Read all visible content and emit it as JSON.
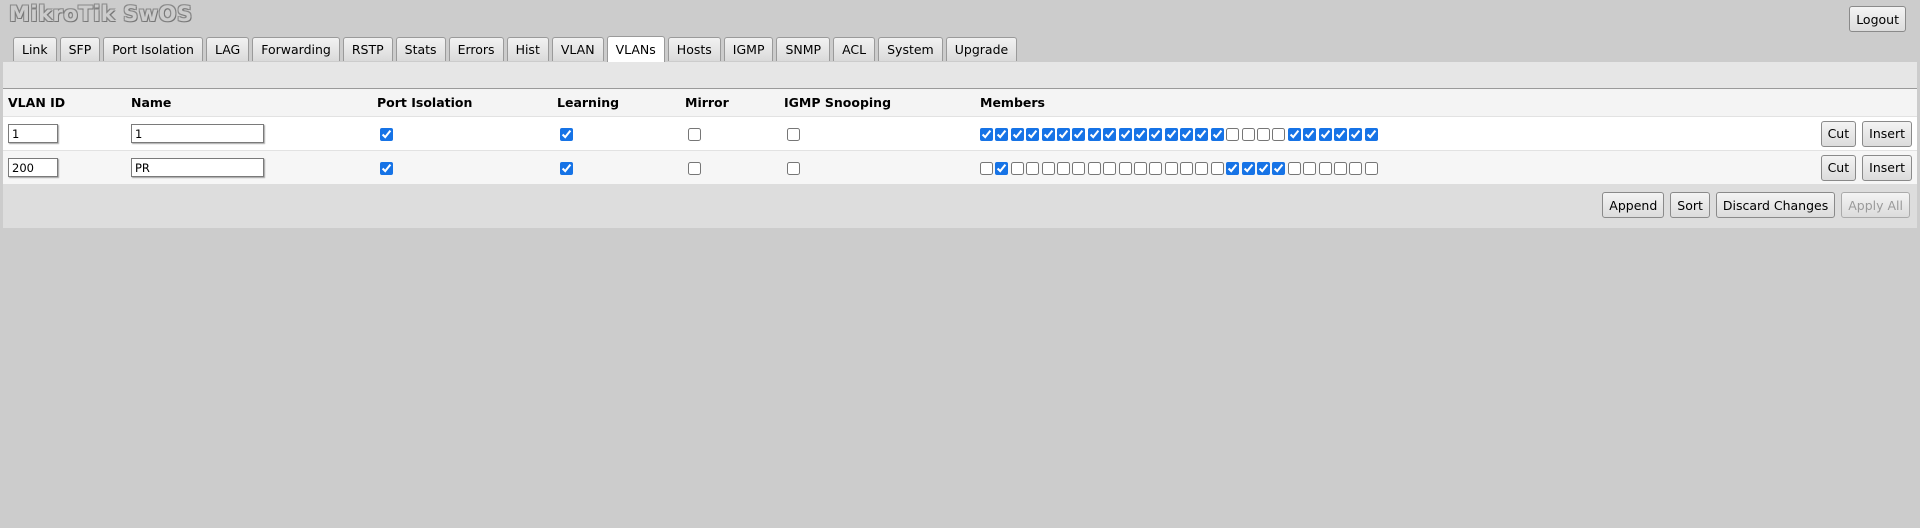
{
  "app": {
    "title": "MikroTik SwOS",
    "logout_label": "Logout"
  },
  "tabs": [
    {
      "label": "Link",
      "active": false
    },
    {
      "label": "SFP",
      "active": false
    },
    {
      "label": "Port Isolation",
      "active": false
    },
    {
      "label": "LAG",
      "active": false
    },
    {
      "label": "Forwarding",
      "active": false
    },
    {
      "label": "RSTP",
      "active": false
    },
    {
      "label": "Stats",
      "active": false
    },
    {
      "label": "Errors",
      "active": false
    },
    {
      "label": "Hist",
      "active": false
    },
    {
      "label": "VLAN",
      "active": false
    },
    {
      "label": "VLANs",
      "active": true
    },
    {
      "label": "Hosts",
      "active": false
    },
    {
      "label": "IGMP",
      "active": false
    },
    {
      "label": "SNMP",
      "active": false
    },
    {
      "label": "ACL",
      "active": false
    },
    {
      "label": "System",
      "active": false
    },
    {
      "label": "Upgrade",
      "active": false
    }
  ],
  "table": {
    "headers": {
      "vlan_id": "VLAN ID",
      "name": "Name",
      "port_isolation": "Port Isolation",
      "learning": "Learning",
      "mirror": "Mirror",
      "igmp_snooping": "IGMP Snooping",
      "members": "Members"
    },
    "rows": [
      {
        "vlan_id": "1",
        "name": "1",
        "port_isolation": true,
        "learning": true,
        "mirror": false,
        "igmp_snooping": false,
        "members": [
          true,
          true,
          true,
          true,
          true,
          true,
          true,
          true,
          true,
          true,
          true,
          true,
          true,
          true,
          true,
          true,
          false,
          false,
          false,
          false,
          true,
          true,
          true,
          true,
          true,
          true
        ]
      },
      {
        "vlan_id": "200",
        "name": "PR",
        "port_isolation": true,
        "learning": true,
        "mirror": false,
        "igmp_snooping": false,
        "members": [
          false,
          true,
          false,
          false,
          false,
          false,
          false,
          false,
          false,
          false,
          false,
          false,
          false,
          false,
          false,
          false,
          true,
          true,
          true,
          true,
          false,
          false,
          false,
          false,
          false,
          false
        ]
      }
    ],
    "row_buttons": {
      "cut_label": "Cut",
      "insert_label": "Insert"
    }
  },
  "actions": {
    "append_label": "Append",
    "sort_label": "Sort",
    "discard_label": "Discard Changes",
    "apply_label": "Apply All"
  },
  "colors": {
    "background": "#cccccc",
    "checkbox_accent": "#1673e6"
  }
}
